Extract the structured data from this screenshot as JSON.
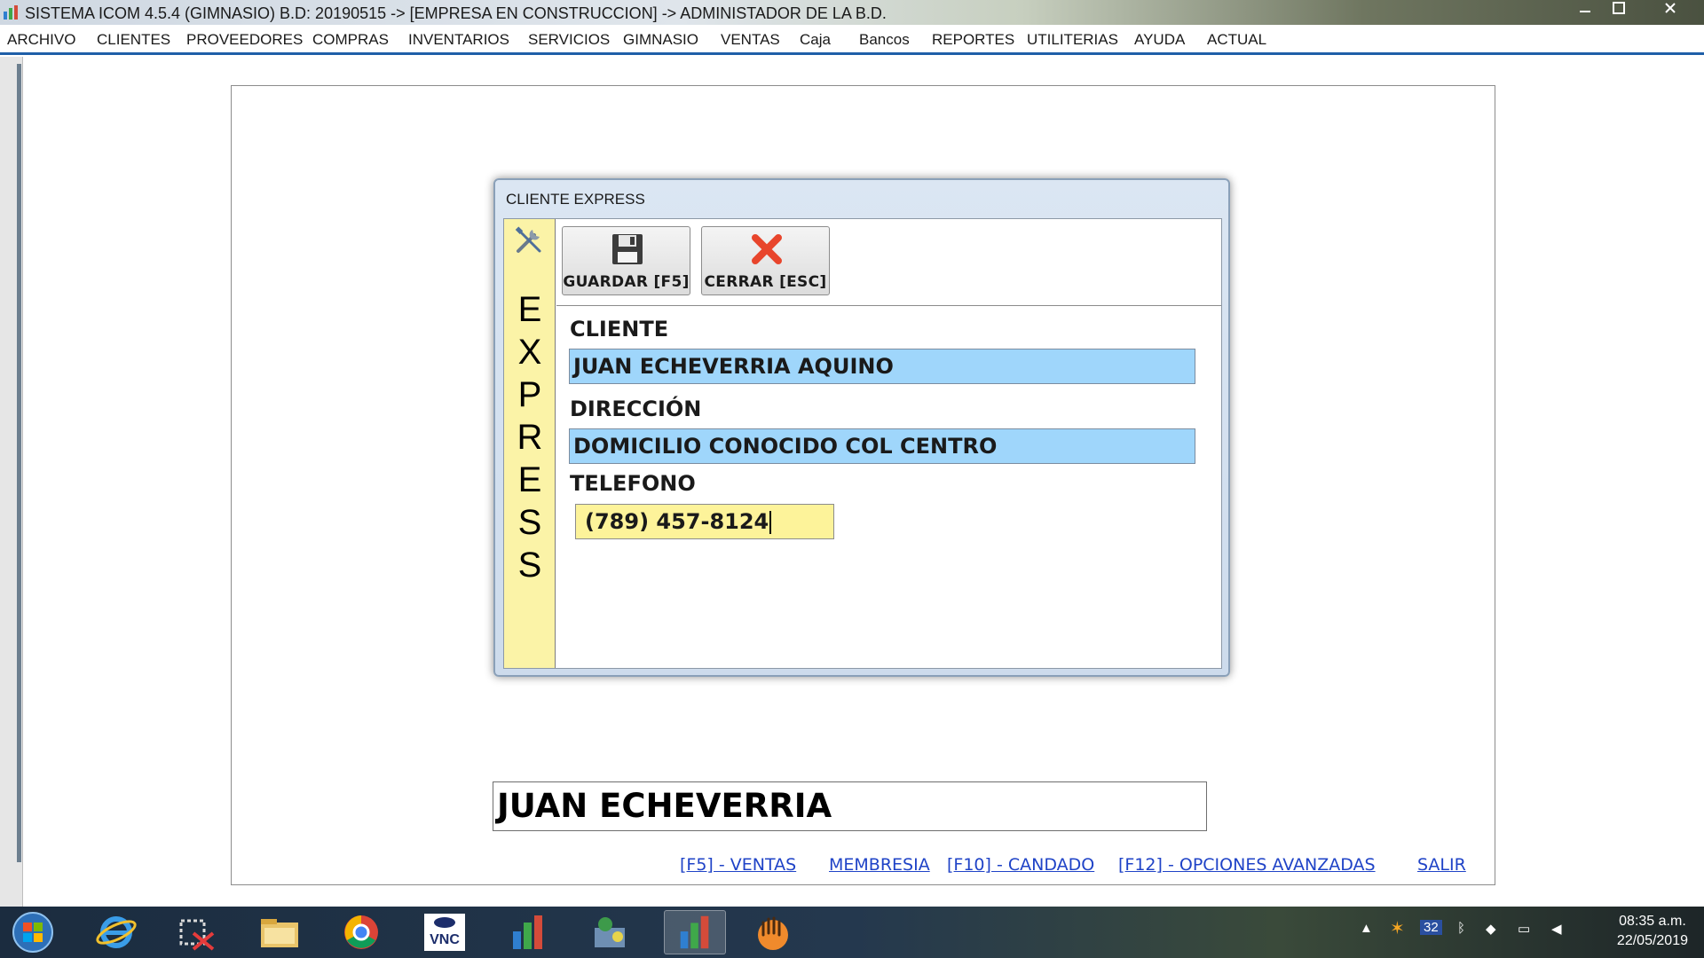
{
  "window": {
    "title": "SISTEMA ICOM 4.5.4 (GIMNASIO)  B.D: 20190515  ->  [EMPRESA EN CONSTRUCCION]  ->  ADMINISTADOR DE LA B.D.",
    "buttons": [
      "minimize",
      "restore",
      "close"
    ]
  },
  "menu": {
    "items": [
      "ARCHIVO",
      "CLIENTES",
      "PROVEEDORES",
      "COMPRAS",
      "INVENTARIOS",
      "SERVICIOS",
      "GIMNASIO",
      "VENTAS",
      "Caja",
      "Bancos",
      "REPORTES",
      "UTILITERIAS",
      "AYUDA",
      "ACTUAL"
    ]
  },
  "dialog": {
    "title": "CLIENTE EXPRESS",
    "side_letters": [
      "E",
      "X",
      "P",
      "R",
      "E",
      "S",
      "S"
    ],
    "toolbar": {
      "save_label": "GUARDAR [F5]",
      "close_label": "CERRAR [ESC]"
    },
    "fields": {
      "cliente_label": "CLIENTE",
      "cliente_value": "JUAN ECHEVERRIA AQUINO",
      "direccion_label": "DIRECCIÓN",
      "direccion_value": "DOMICILIO CONOCIDO COL CENTRO",
      "telefono_label": "TELEFONO",
      "telefono_value": "(789) 457-8124"
    }
  },
  "main": {
    "name_value": "JUAN ECHEVERRIA",
    "links": [
      "[F5] - VENTAS",
      "MEMBRESIA",
      "[F10] - CANDADO",
      "[F12] - OPCIONES AVANZADAS",
      "SALIR"
    ]
  },
  "taskbar": {
    "apps": [
      "windows-start",
      "internet-explorer",
      "snipping-tool",
      "file-explorer",
      "chrome",
      "vnc-viewer",
      "icom-app",
      "bird-app",
      "icom-app-active",
      "gesture-app"
    ],
    "tray_number": "32",
    "time": "08:35 a.m.",
    "date": "22/05/2019"
  },
  "colors": {
    "menu_underline": "#1f5fa8",
    "field_blue": "#9fd6fb",
    "field_yellow": "#fdf39a",
    "side_yellow": "#fbf3a7",
    "link_blue": "#1f43c7"
  }
}
